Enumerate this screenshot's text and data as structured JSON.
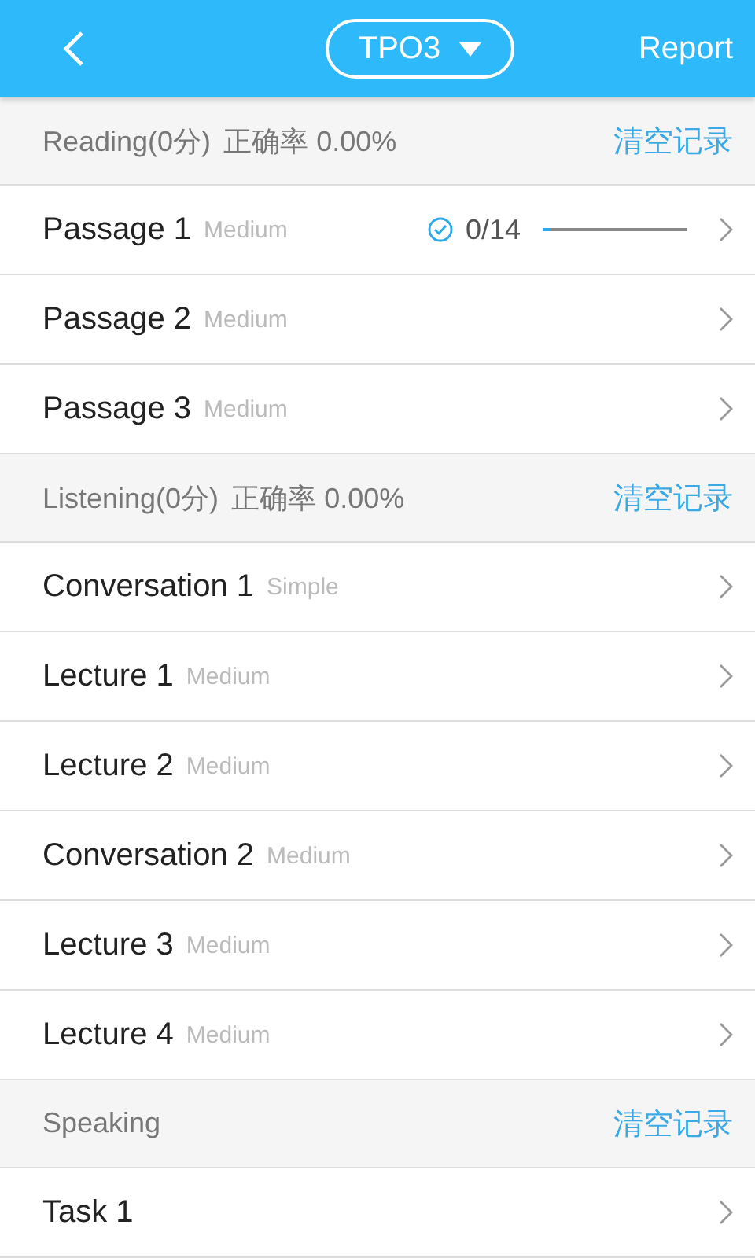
{
  "header": {
    "test": "TPO3",
    "report": "Report"
  },
  "sections": [
    {
      "title": "Reading(0分)",
      "accuracy": "正确率 0.00%",
      "clear": "清空记录",
      "items": [
        {
          "name": "Passage 1",
          "difficulty": "Medium",
          "progress": {
            "score": "0/14",
            "level": 0.05
          }
        },
        {
          "name": "Passage 2",
          "difficulty": "Medium"
        },
        {
          "name": "Passage 3",
          "difficulty": "Medium"
        }
      ]
    },
    {
      "title": "Listening(0分)",
      "accuracy": "正确率 0.00%",
      "clear": "清空记录",
      "items": [
        {
          "name": "Conversation 1",
          "difficulty": "Simple"
        },
        {
          "name": "Lecture 1",
          "difficulty": "Medium"
        },
        {
          "name": "Lecture 2",
          "difficulty": "Medium"
        },
        {
          "name": "Conversation 2",
          "difficulty": "Medium"
        },
        {
          "name": "Lecture 3",
          "difficulty": "Medium"
        },
        {
          "name": "Lecture 4",
          "difficulty": "Medium"
        }
      ]
    },
    {
      "title": "Speaking",
      "clear": "清空记录",
      "items": [
        {
          "name": "Task 1"
        }
      ]
    }
  ]
}
